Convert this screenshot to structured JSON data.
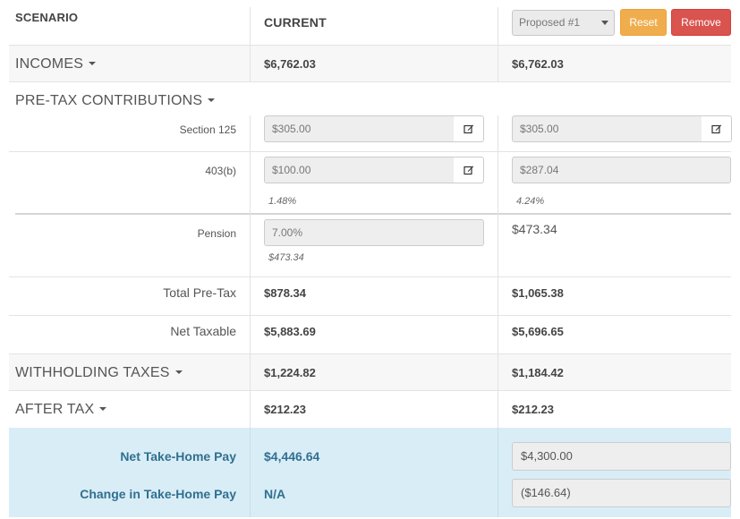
{
  "header": {
    "scenario_label": "SCENARIO",
    "current_label": "CURRENT",
    "proposed_select": "Proposed #1",
    "reset_label": "Reset",
    "remove_label": "Remove"
  },
  "incomes": {
    "label": "INCOMES",
    "current": "$6,762.03",
    "proposed": "$6,762.03"
  },
  "pretax": {
    "label": "PRE-TAX CONTRIBUTIONS",
    "section125": {
      "label": "Section 125",
      "current": "$305.00",
      "proposed": "$305.00"
    },
    "b403": {
      "label": "403(b)",
      "current": "$100.00",
      "proposed": "$287.04",
      "current_pct": "1.48%",
      "proposed_pct": "4.24%"
    },
    "pension": {
      "label": "Pension",
      "current": "7.00%",
      "current_amount": "$473.34",
      "proposed": "$473.34"
    },
    "total": {
      "label": "Total Pre-Tax",
      "current": "$878.34",
      "proposed": "$1,065.38"
    },
    "net_taxable": {
      "label": "Net Taxable",
      "current": "$5,883.69",
      "proposed": "$5,696.65"
    }
  },
  "withholding": {
    "label": "WITHHOLDING TAXES",
    "current": "$1,224.82",
    "proposed": "$1,184.42"
  },
  "after_tax": {
    "label": "AFTER TAX",
    "current": "$212.23",
    "proposed": "$212.23"
  },
  "summary": {
    "net_label": "Net Take-Home Pay",
    "net_current": "$4,446.64",
    "net_proposed": "$4,300.00",
    "change_label": "Change in Take-Home Pay",
    "change_current": "N/A",
    "change_proposed": "($146.64)"
  },
  "icons": {
    "edit": "edit-icon",
    "caret": "caret-down-icon",
    "select_arrow": "select-arrow-icon"
  },
  "colors": {
    "reset": "#f0ad4e",
    "remove": "#d9534f",
    "summary_bg": "#d9edf7",
    "summary_text": "#31708f"
  }
}
